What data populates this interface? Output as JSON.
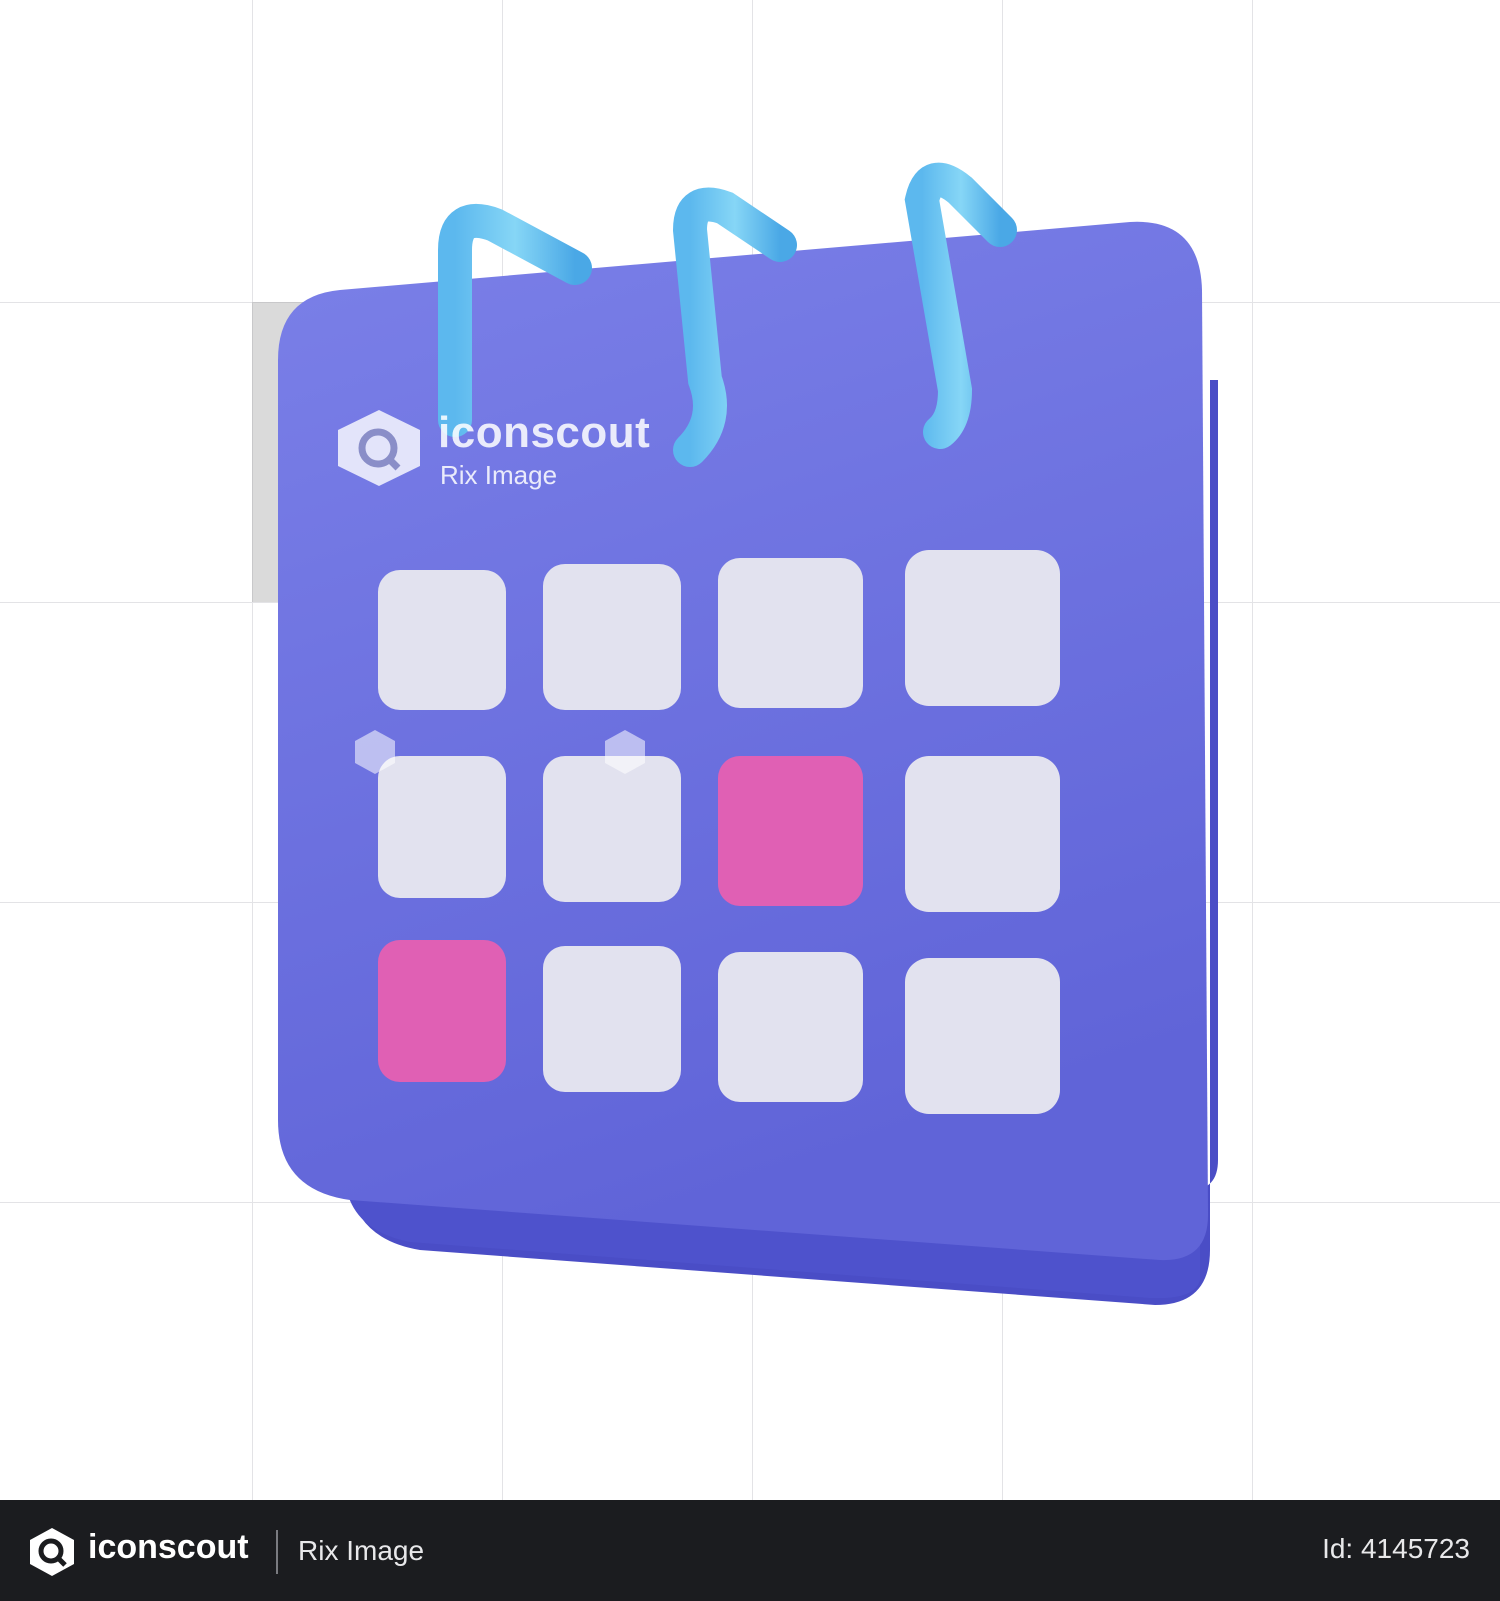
{
  "watermark": {
    "brand": "iconscout",
    "subtitle": "Rix Image"
  },
  "footer": {
    "brand": "iconscout",
    "subtitle": "Rix Image",
    "asset_id": "Id: 4145723"
  },
  "illustration": {
    "subject": "calendar-3d-icon",
    "colors": {
      "body": "#6e73e0",
      "body_edge": "#5457cc",
      "rings": "#6cc6f0",
      "tile": "#e2e2ef",
      "highlight_tile": "#e060b4"
    },
    "tile_grid": {
      "rows": 3,
      "columns": 4,
      "highlighted": [
        [
          1,
          2
        ],
        [
          2,
          0
        ]
      ]
    }
  }
}
